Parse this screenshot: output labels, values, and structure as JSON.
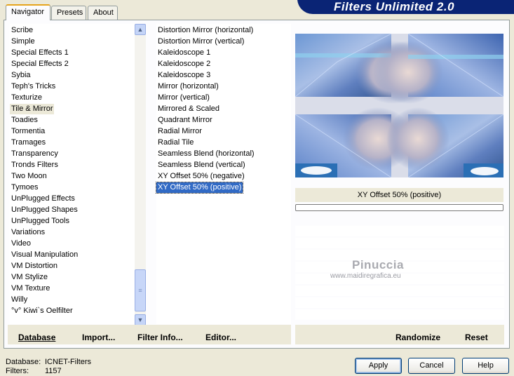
{
  "tabs": [
    {
      "label": "Navigator"
    },
    {
      "label": "Presets"
    },
    {
      "label": "About"
    }
  ],
  "banner": {
    "title": "Filters Unlimited 2.0"
  },
  "categories": [
    "Scribe",
    "Simple",
    "Special Effects 1",
    "Special Effects 2",
    "Sybia",
    "Teph's Tricks",
    "Texturize",
    "Tile & Mirror",
    "Toadies",
    "Tormentia",
    "Tramages",
    "Transparency",
    "Tronds Filters",
    "Two Moon",
    "Tymoes",
    "UnPlugged Effects",
    "UnPlugged Shapes",
    "UnPlugged Tools",
    "Variations",
    "Video",
    "Visual Manipulation",
    "VM Distortion",
    "VM Stylize",
    "VM Texture",
    "Willy",
    "°v° Kiwi`s Oelfilter"
  ],
  "selected_category_index": 7,
  "filters": [
    "Distortion Mirror (horizontal)",
    "Distortion Mirror (vertical)",
    "Kaleidoscope 1",
    "Kaleidoscope 2",
    "Kaleidoscope 3",
    "Mirror (horizontal)",
    "Mirror (vertical)",
    "Mirrored & Scaled",
    "Quadrant Mirror",
    "Radial Mirror",
    "Radial Tile",
    "Seamless Blend (horizontal)",
    "Seamless Blend (vertical)",
    "XY Offset 50% (negative)",
    "XY Offset 50% (positive)"
  ],
  "selected_filter_index": 14,
  "list_actions": {
    "database": "Database",
    "import": "Import...",
    "filter_info": "Filter Info...",
    "editor": "Editor..."
  },
  "preview": {
    "filter_name": "XY Offset 50% (positive)",
    "progress_fraction": 0,
    "watermark_name": "Pinuccia",
    "watermark_url": "www.maidiregrafica.eu"
  },
  "preview_actions": {
    "randomize": "Randomize",
    "reset": "Reset"
  },
  "status": {
    "database_label": "Database:",
    "database_value": "ICNET-Filters",
    "filters_label": "Filters:",
    "filters_value": "1157"
  },
  "buttons": {
    "apply": "Apply",
    "cancel": "Cancel",
    "help": "Help"
  },
  "colors": {
    "selection_blue": "#316ac5",
    "banner_navy": "#0a2475",
    "dialog_face": "#ece9d8"
  }
}
